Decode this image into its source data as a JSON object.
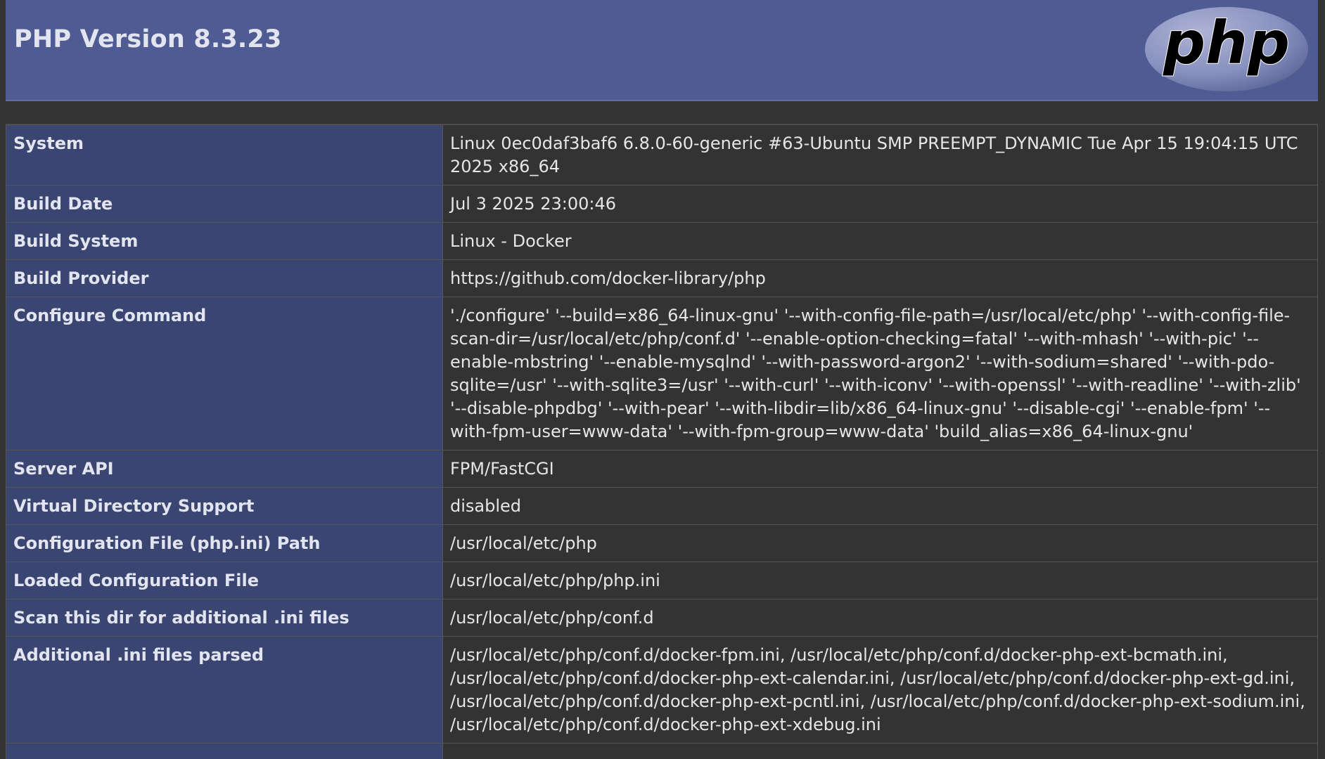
{
  "header": {
    "title": "PHP Version 8.3.23",
    "logo_text": "php",
    "logo_icon": "php-logo-icon",
    "colors": {
      "header_bg": "#4f5b93",
      "key_bg": "#3b4572",
      "page_bg": "#333333",
      "logo_ellipse": "#8892bf"
    }
  },
  "rows": [
    {
      "key": "System",
      "value": "Linux 0ec0daf3baf6 6.8.0-60-generic #63-Ubuntu SMP PREEMPT_DYNAMIC Tue Apr 15 19:04:15 UTC 2025 x86_64"
    },
    {
      "key": "Build Date",
      "value": "Jul 3 2025 23:00:46"
    },
    {
      "key": "Build System",
      "value": "Linux - Docker"
    },
    {
      "key": "Build Provider",
      "value": "https://github.com/docker-library/php"
    },
    {
      "key": "Configure Command",
      "value": "'./configure' '--build=x86_64-linux-gnu' '--with-config-file-path=/usr/local/etc/php' '--with-config-file-scan-dir=/usr/local/etc/php/conf.d' '--enable-option-checking=fatal' '--with-mhash' '--with-pic' '--enable-mbstring' '--enable-mysqlnd' '--with-password-argon2' '--with-sodium=shared' '--with-pdo-sqlite=/usr' '--with-sqlite3=/usr' '--with-curl' '--with-iconv' '--with-openssl' '--with-readline' '--with-zlib' '--disable-phpdbg' '--with-pear' '--with-libdir=lib/x86_64-linux-gnu' '--disable-cgi' '--enable-fpm' '--with-fpm-user=www-data' '--with-fpm-group=www-data' 'build_alias=x86_64-linux-gnu'"
    },
    {
      "key": "Server API",
      "value": "FPM/FastCGI"
    },
    {
      "key": "Virtual Directory Support",
      "value": "disabled"
    },
    {
      "key": "Configuration File (php.ini) Path",
      "value": "/usr/local/etc/php"
    },
    {
      "key": "Loaded Configuration File",
      "value": "/usr/local/etc/php/php.ini"
    },
    {
      "key": "Scan this dir for additional .ini files",
      "value": "/usr/local/etc/php/conf.d"
    },
    {
      "key": "Additional .ini files parsed",
      "value": "/usr/local/etc/php/conf.d/docker-fpm.ini, /usr/local/etc/php/conf.d/docker-php-ext-bcmath.ini, /usr/local/etc/php/conf.d/docker-php-ext-calendar.ini, /usr/local/etc/php/conf.d/docker-php-ext-gd.ini, /usr/local/etc/php/conf.d/docker-php-ext-pcntl.ini, /usr/local/etc/php/conf.d/docker-php-ext-sodium.ini, /usr/local/etc/php/conf.d/docker-php-ext-xdebug.ini"
    }
  ]
}
